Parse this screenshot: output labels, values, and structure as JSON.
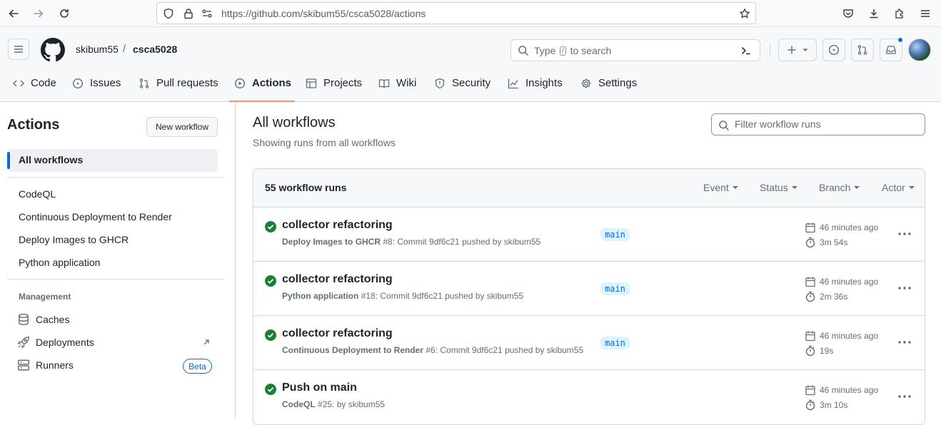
{
  "browser": {
    "url": "https://github.com/skibum55/csca5028/actions"
  },
  "header": {
    "owner": "skibum55",
    "separator": "/",
    "repo": "csca5028",
    "search_prefix": "Type",
    "search_key": "/",
    "search_suffix": "to search"
  },
  "tabs": [
    {
      "label": "Code",
      "icon": "code-icon"
    },
    {
      "label": "Issues",
      "icon": "issue-icon"
    },
    {
      "label": "Pull requests",
      "icon": "pull-request-icon"
    },
    {
      "label": "Actions",
      "icon": "play-icon",
      "active": true
    },
    {
      "label": "Projects",
      "icon": "table-icon"
    },
    {
      "label": "Wiki",
      "icon": "book-icon"
    },
    {
      "label": "Security",
      "icon": "shield-icon"
    },
    {
      "label": "Insights",
      "icon": "graph-icon"
    },
    {
      "label": "Settings",
      "icon": "gear-icon"
    }
  ],
  "sidebar": {
    "title": "Actions",
    "new_workflow": "New workflow",
    "all_workflows": "All workflows",
    "workflows": [
      "CodeQL",
      "Continuous Deployment to Render",
      "Deploy Images to GHCR",
      "Python application"
    ],
    "management_heading": "Management",
    "management": [
      {
        "label": "Caches",
        "icon": "database-icon"
      },
      {
        "label": "Deployments",
        "icon": "rocket-icon"
      },
      {
        "label": "Runners",
        "icon": "server-icon"
      }
    ],
    "beta_badge": "Beta"
  },
  "main": {
    "title": "All workflows",
    "subtitle": "Showing runs from all workflows",
    "filter_placeholder": "Filter workflow runs",
    "runs_count": "55 workflow runs",
    "filters": [
      "Event",
      "Status",
      "Branch",
      "Actor"
    ],
    "runs": [
      {
        "title": "collector refactoring",
        "workflow": "Deploy Images to GHCR",
        "detail": "#8: Commit 9df6c21 pushed by skibum55",
        "branch": "main",
        "time": "46 minutes ago",
        "duration": "3m 54s"
      },
      {
        "title": "collector refactoring",
        "workflow": "Python application",
        "detail": "#18: Commit 9df6c21 pushed by skibum55",
        "branch": "main",
        "time": "46 minutes ago",
        "duration": "2m 36s"
      },
      {
        "title": "collector refactoring",
        "workflow": "Continuous Deployment to Render",
        "detail": "#6: Commit 9df6c21 pushed by skibum55",
        "branch": "main",
        "time": "46 minutes ago",
        "duration": "19s"
      },
      {
        "title": "Push on main",
        "workflow": "CodeQL",
        "detail": "#25: by skibum55",
        "branch": "",
        "time": "46 minutes ago",
        "duration": "3m 10s"
      }
    ]
  },
  "colors": {
    "accent": "#0969da",
    "success": "#1a7f37",
    "tab_underline": "#fd8c73"
  }
}
